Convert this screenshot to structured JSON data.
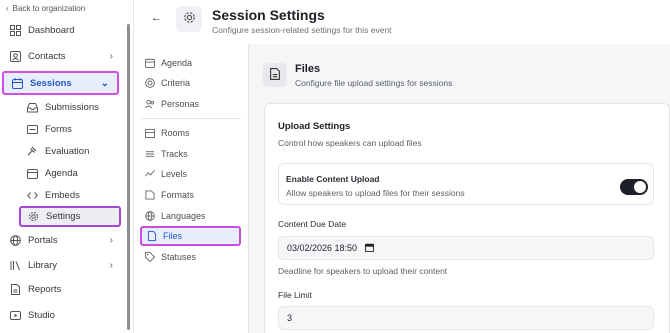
{
  "nav": {
    "back_label": "Back to organization",
    "items": [
      {
        "label": "Dashboard",
        "icon": "grid-icon"
      },
      {
        "label": "Contacts",
        "icon": "contacts-icon"
      },
      {
        "label": "Sessions",
        "icon": "calendar-icon"
      },
      {
        "label": "Portals",
        "icon": "globe-icon"
      },
      {
        "label": "Library",
        "icon": "library-icon"
      },
      {
        "label": "Reports",
        "icon": "report-icon"
      },
      {
        "label": "Studio",
        "icon": "studio-icon"
      }
    ],
    "sessions_sub": [
      {
        "label": "Submissions",
        "icon": "inbox-icon"
      },
      {
        "label": "Forms",
        "icon": "form-icon"
      },
      {
        "label": "Evaluation",
        "icon": "gavel-icon"
      },
      {
        "label": "Agenda",
        "icon": "agenda-icon"
      },
      {
        "label": "Embeds",
        "icon": "code-icon"
      },
      {
        "label": "Settings",
        "icon": "gear-icon"
      }
    ]
  },
  "header": {
    "title": "Session Settings",
    "subtitle": "Configure session-related settings for this event"
  },
  "menu": {
    "group1": [
      {
        "label": "Agenda",
        "icon": "agenda-icon"
      },
      {
        "label": "Criteria",
        "icon": "target-icon"
      },
      {
        "label": "Personas",
        "icon": "people-icon"
      }
    ],
    "group2": [
      {
        "label": "Rooms",
        "icon": "room-icon"
      },
      {
        "label": "Tracks",
        "icon": "tracks-icon"
      },
      {
        "label": "Levels",
        "icon": "levels-icon"
      },
      {
        "label": "Formats",
        "icon": "formats-icon"
      },
      {
        "label": "Languages",
        "icon": "globe-icon"
      },
      {
        "label": "Files",
        "icon": "file-icon"
      },
      {
        "label": "Statuses",
        "icon": "tag-icon"
      }
    ]
  },
  "files": {
    "title": "Files",
    "subtitle": "Configure file upload settings for sessions",
    "upload": {
      "title": "Upload Settings",
      "desc": "Control how speakers can upload files",
      "enable_title": "Enable Content Upload",
      "enable_desc": "Allow speakers to upload files for their sessions",
      "enabled": true,
      "due_label": "Content Due Date",
      "due_value": "03/02/2026 18:50",
      "due_hint": "Deadline for speakers to upload their content",
      "limit_label": "File Limit",
      "limit_value": "3"
    }
  }
}
